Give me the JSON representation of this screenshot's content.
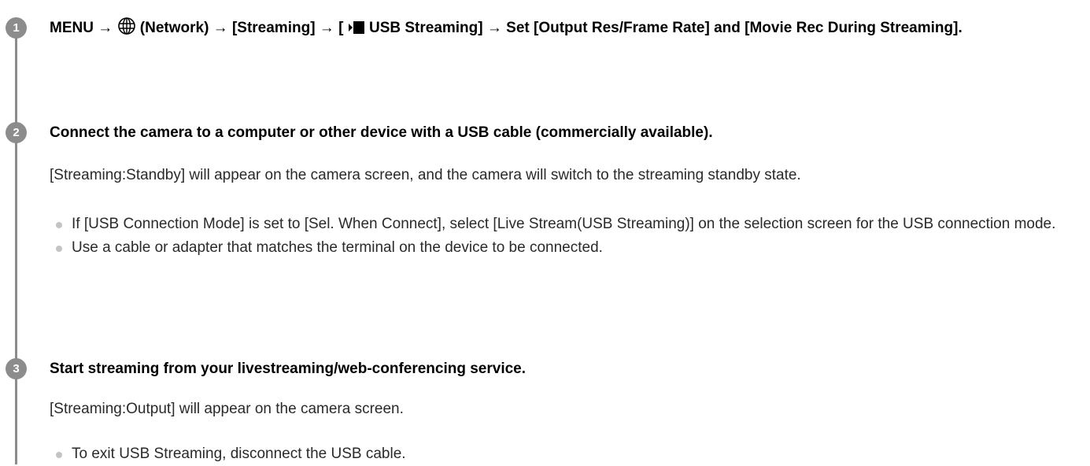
{
  "steps": [
    {
      "number": "1",
      "title_parts": {
        "menu": "MENU → ",
        "network": " (Network) → [Streaming] → [ ",
        "usb_streaming": " USB Streaming] → Set [Output Res/Frame Rate] and [Movie Rec During Streaming]."
      },
      "icons": [
        "globe-network-icon",
        "usb-streaming-icon"
      ]
    },
    {
      "number": "2",
      "title": "Connect the camera to a computer or other device with a USB cable (commercially available).",
      "body": "[Streaming:Standby] will appear on the camera screen, and the camera will switch to the streaming standby state.",
      "bullets": [
        "If [USB Connection Mode] is set to [Sel. When Connect], select [Live Stream(USB Streaming)] on the selection screen for the USB connection mode.",
        "Use a cable or adapter that matches the terminal on the device to be connected."
      ]
    },
    {
      "number": "3",
      "title": "Start streaming from your livestreaming/web-conferencing service.",
      "body": "[Streaming:Output] will appear on the camera screen.",
      "bullets": [
        "To exit USB Streaming, disconnect the USB cable."
      ]
    }
  ],
  "colors": {
    "badge": "#8c8c8c",
    "bullet": "#c4c4c4",
    "title": "#000000",
    "body": "#2a2a2a"
  }
}
